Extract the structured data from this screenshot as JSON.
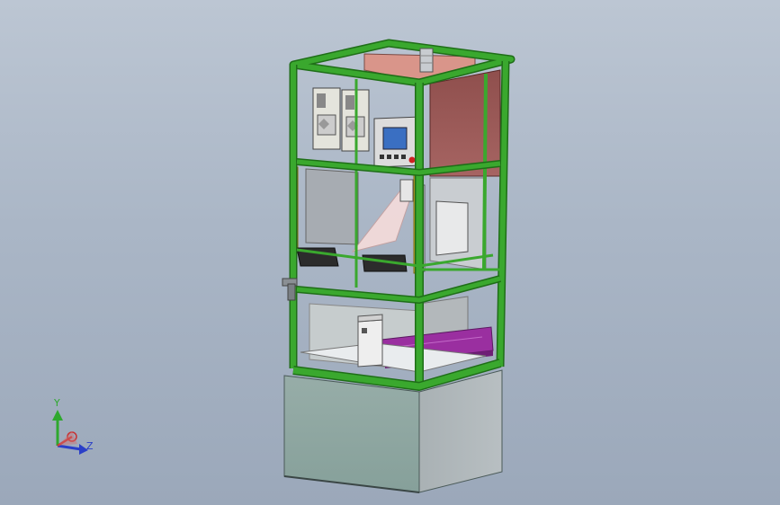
{
  "viewport": {
    "background_top": "#bcc6d3",
    "background_bottom": "#9ba8ba"
  },
  "model": {
    "frame_color": "#3aa82e",
    "frame_dark": "#1f6e18",
    "base_color": "#8fa8a2",
    "back_panel_color": "#9b5a58",
    "top_panel_color": "#d08c80",
    "tray_color": "#9a2fa0",
    "guard_color": "#c8b432"
  },
  "triad": {
    "y_label": "Y",
    "z_label": "Z",
    "y_color": "#2ea82e",
    "z_color": "#2a3fc8",
    "x_color": "#c83030",
    "icons": [
      "axis-triad-icon"
    ]
  }
}
